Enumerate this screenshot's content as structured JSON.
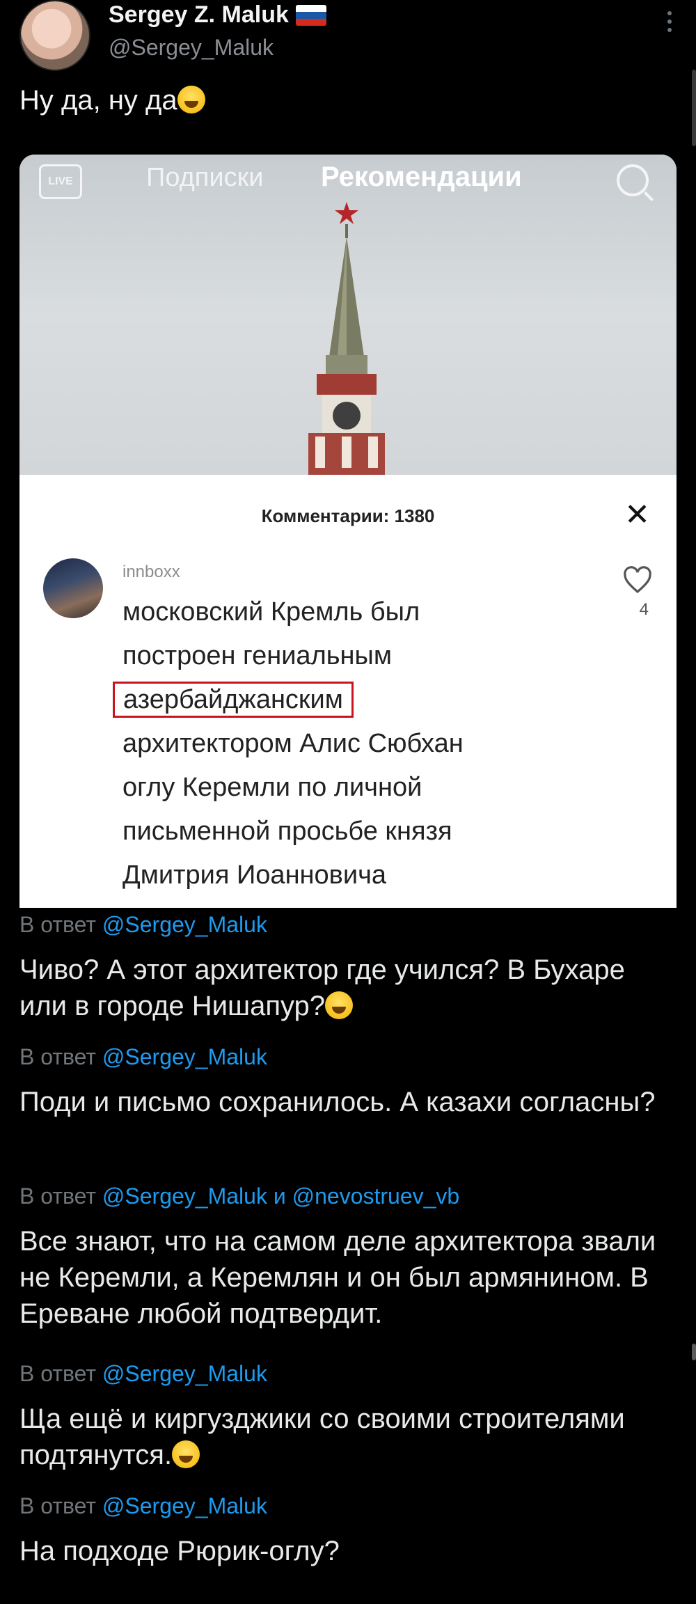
{
  "post": {
    "author_name": "Sergey Z. Maluk",
    "author_handle": "@Sergey_Maluk",
    "text": "Ну да, ну да",
    "flag_colors": [
      "#ffffff",
      "#1c57a5",
      "#d52b1e"
    ]
  },
  "media": {
    "live_label": "LIVE",
    "tab_following": "Подписки",
    "tab_recommended": "Рекомендации",
    "comments_title": "Комментарии: 1380",
    "comment": {
      "username": "innboxx",
      "lines": [
        "московский Кремль был",
        "построен гениальным",
        "азербайджанским",
        "архитектором Алис Сюбхан",
        "оглу Керемли по личной",
        "письменной просьбе князя",
        "Дмитрия Иоанновича"
      ],
      "likes": "4"
    }
  },
  "replies": [
    {
      "prefix": "В ответ",
      "mentions": "@Sergey_Maluk",
      "text": "Чиво? А этот архитектор где учился? В Бухаре или в городе Нишапур?"
    },
    {
      "prefix": "В ответ",
      "mentions": "@Sergey_Maluk",
      "text": "Поди и письмо сохранилось. А казахи согласны?"
    },
    {
      "prefix": "В ответ",
      "mentions": "@Sergey_Maluk и @nevostruev_vb",
      "text": "Все знают, что на самом деле архитектора звали не Керемли, а Керемлян и он был армянином. В Ереване любой подтвердит."
    },
    {
      "prefix": "В ответ",
      "mentions": "@Sergey_Maluk",
      "text": "Ща ещё и киргузджики со своими строителями подтянутся."
    },
    {
      "prefix": "В ответ",
      "mentions": "@Sergey_Maluk",
      "text": "На подходе Рюрик-оглу?"
    }
  ]
}
